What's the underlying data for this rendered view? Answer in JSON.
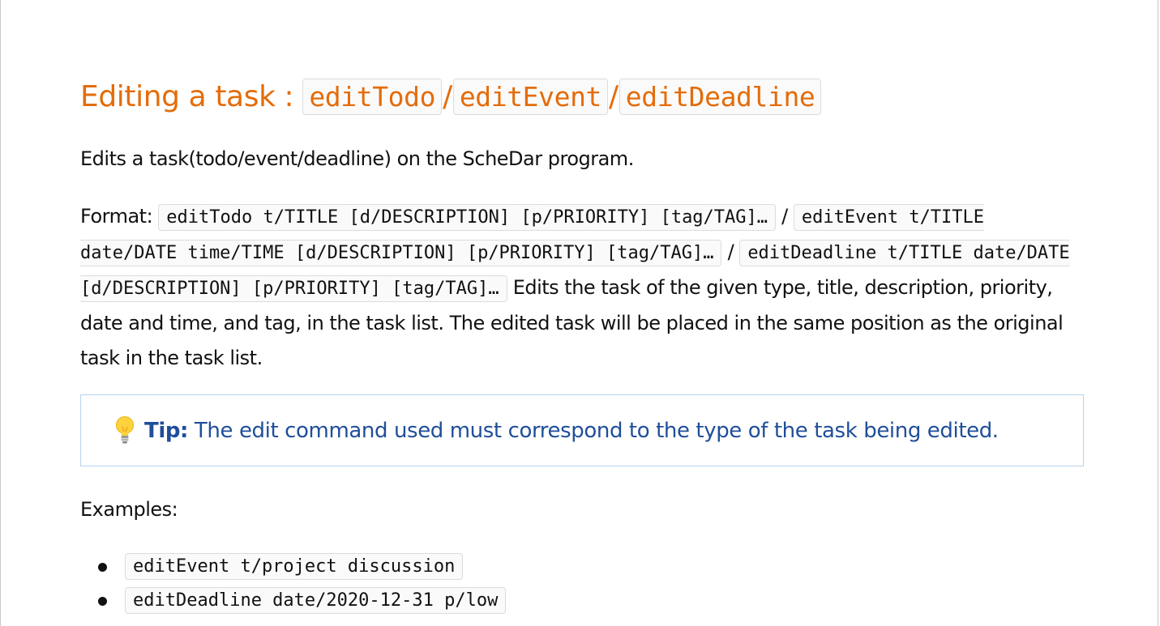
{
  "heading": {
    "prefix": "Editing a task : ",
    "cmd1": "editTodo",
    "sep1": "/",
    "cmd2": "editEvent",
    "sep2": "/",
    "cmd3": "editDeadline"
  },
  "description": "Edits a task(todo/event/deadline) on the ScheDar program.",
  "format": {
    "label": "Format: ",
    "code1": "editTodo t/TITLE [d/DESCRIPTION] [p/PRIORITY] [tag/TAG]…",
    "sep1": " / ",
    "code2": "editEvent t/TITLE date/DATE time/TIME [d/DESCRIPTION] [p/PRIORITY] [tag/TAG]…",
    "sep2": " / ",
    "code3": "editDeadline t/TITLE date/DATE [d/DESCRIPTION] [p/PRIORITY] [tag/TAG]…",
    "text": " Edits the task of the given type, title, description, priority, date and time, and tag, in the task list. The edited task will be placed in the same position as the original task in the task list."
  },
  "tip": {
    "icon": "lightbulb-icon",
    "label": "Tip:",
    "text": " The edit command used must correspond to the type of the task being edited."
  },
  "examples_label": "Examples:",
  "examples": [
    "editEvent t/project discussion",
    "editDeadline date/2020-12-31 p/low"
  ],
  "colors": {
    "heading": "#e46c0a",
    "tip_text": "#1f4e9a",
    "tip_border": "#b8d4ef"
  }
}
